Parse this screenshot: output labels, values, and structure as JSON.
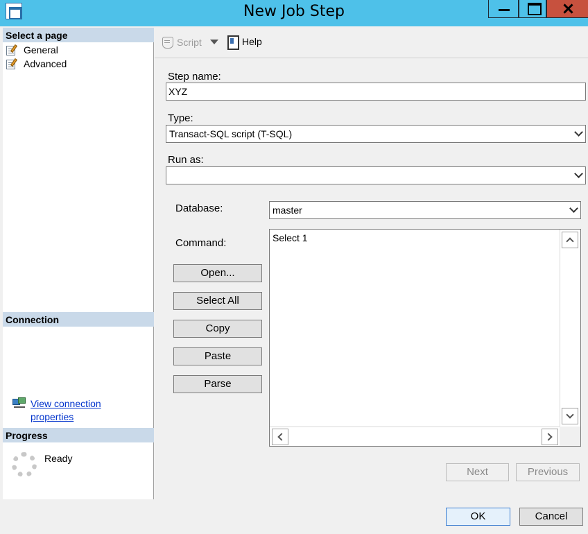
{
  "window": {
    "title": "New Job Step"
  },
  "left_pane": {
    "select_page_header": "Select a page",
    "pages": [
      {
        "label": "General",
        "icon": "page-icon"
      },
      {
        "label": "Advanced",
        "icon": "page-icon"
      }
    ],
    "connection_header": "Connection",
    "view_connection_line1": "View connection",
    "view_connection_line2": "properties",
    "progress_header": "Progress",
    "progress_status": "Ready"
  },
  "toolbar": {
    "script_label": "Script",
    "help_label": "Help"
  },
  "form": {
    "step_name_label": "Step name:",
    "step_name_value": "XYZ",
    "type_label": "Type:",
    "type_value": "Transact-SQL script (T-SQL)",
    "run_as_label": "Run as:",
    "run_as_value": "",
    "database_label": "Database:",
    "database_value": "master",
    "command_label": "Command:",
    "command_value": "Select 1"
  },
  "command_buttons": {
    "open": "Open...",
    "select_all": "Select All",
    "copy": "Copy",
    "paste": "Paste",
    "parse": "Parse"
  },
  "nav_buttons": {
    "next": "Next",
    "previous": "Previous"
  },
  "footer_buttons": {
    "ok": "OK",
    "cancel": "Cancel"
  },
  "colors": {
    "titlebar": "#4ec1e9",
    "close": "#c7513e",
    "section_header": "#c9d9e9",
    "link": "#0033cc"
  }
}
